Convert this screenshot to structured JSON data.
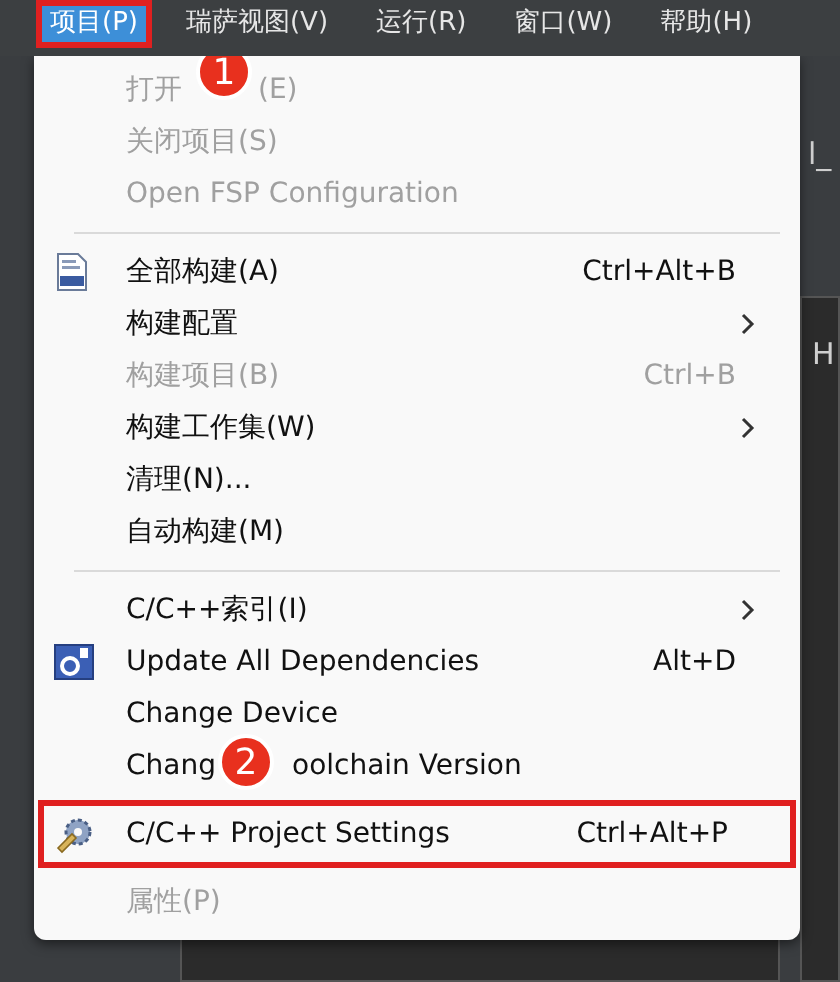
{
  "menubar": [
    {
      "label": "项目(P)",
      "selected": true,
      "highlighted": true
    },
    {
      "label": "瑞萨视图(V)",
      "selected": false,
      "highlighted": false
    },
    {
      "label": "运行(R)",
      "selected": false,
      "highlighted": false
    },
    {
      "label": "窗口(W)",
      "selected": false,
      "highlighted": false
    },
    {
      "label": "帮助(H)",
      "selected": false,
      "highlighted": false
    }
  ],
  "background_fragments": [
    "l_",
    "H"
  ],
  "menu": {
    "items": [
      {
        "kind": "plain",
        "label": "打开",
        "label_after": "(E)",
        "disabled": true
      },
      {
        "kind": "plain",
        "label": "关闭项目(S)",
        "disabled": true
      },
      {
        "kind": "plain",
        "label": "Open FSP Configuration",
        "disabled": true
      },
      {
        "kind": "separator"
      },
      {
        "kind": "build",
        "label": "全部构建(A)",
        "shortcut": "Ctrl+Alt+B",
        "disabled": false
      },
      {
        "kind": "plain",
        "label": "构建配置",
        "submenu": true,
        "disabled": false
      },
      {
        "kind": "plain",
        "label": "构建项目(B)",
        "shortcut": "Ctrl+B",
        "disabled": true
      },
      {
        "kind": "plain",
        "label": "构建工作集(W)",
        "submenu": true,
        "disabled": false
      },
      {
        "kind": "plain",
        "label": "清理(N)...",
        "disabled": false
      },
      {
        "kind": "plain",
        "label": "自动构建(M)",
        "disabled": false
      },
      {
        "kind": "separator"
      },
      {
        "kind": "plain",
        "label": "C/C++索引(I)",
        "submenu": true,
        "disabled": false
      },
      {
        "kind": "update",
        "label": "Update All Dependencies",
        "shortcut": "Alt+D",
        "disabled": false
      },
      {
        "kind": "plain",
        "label": "Change Device",
        "disabled": false
      },
      {
        "kind": "plain",
        "label": "Chang",
        "label_after": "oolchain Version",
        "disabled": false,
        "step_badge": "2"
      },
      {
        "kind": "settings",
        "label": "C/C++ Project Settings",
        "shortcut": "Ctrl+Alt+P",
        "disabled": false,
        "highlighted": true
      },
      {
        "kind": "plain",
        "label": "属性(P)",
        "disabled": true
      }
    ]
  },
  "step_badges": [
    {
      "label": "1"
    }
  ]
}
